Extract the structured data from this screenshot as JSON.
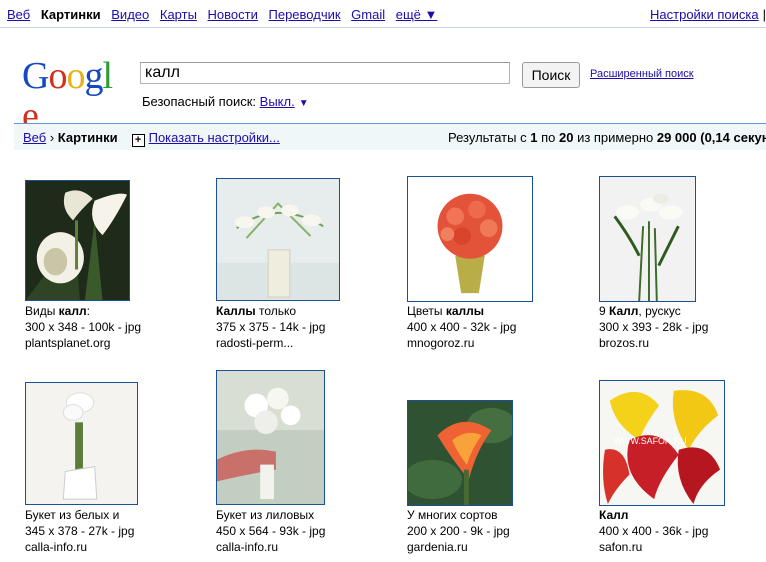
{
  "topnav": {
    "items": [
      "Веб",
      "Картинки",
      "Видео",
      "Карты",
      "Новости",
      "Переводчик",
      "Gmail"
    ],
    "more_label": "ещё ▼",
    "settings_label": "Настройки поиска",
    "separator": "|"
  },
  "logo_letters": [
    "G",
    "o",
    "o",
    "g",
    "l",
    "e"
  ],
  "search": {
    "query": "калл",
    "button_label": "Поиск",
    "advanced_label": "Расширенный поиск"
  },
  "safe_search": {
    "label": "Безопасный поиск:",
    "value": "Выкл.",
    "arrow": "▼"
  },
  "results_bar": {
    "crumb_web": "Веб",
    "crumb_sep": "›",
    "crumb_current": "Картинки",
    "plus": "+",
    "show_settings": "Показать настройки...",
    "stats_prefix": "Результаты с",
    "from": "1",
    "to_word": "по",
    "to": "20",
    "of_word": "из примерно",
    "total": "29 000",
    "time": "(0,14 секун"
  },
  "colors": {
    "link": "#1a0dab",
    "domain": "#228822",
    "meta": "#666666",
    "bar_bg": "#f0f7f9"
  },
  "results": [
    {
      "t1": "Виды ",
      "tb": "калл",
      "t2": ":",
      "meta": "300 x 348 - 100k - jpg",
      "domain": "plantsplanet.org",
      "icon": "white-calla-photo"
    },
    {
      "t1": "",
      "tb": "Каллы",
      "t2": " только",
      "meta": "375 x 375 - 14k - jpg",
      "domain": "radosti-perm...",
      "icon": "calla-vase-photo"
    },
    {
      "t1": "Цветы ",
      "tb": "каллы",
      "t2": "",
      "meta": "400 x 400 - 32k - jpg",
      "domain": "mnogoroz.ru",
      "icon": "orange-bouquet-photo"
    },
    {
      "t1": "9 ",
      "tb": "Калл",
      "t2": ", рускус",
      "meta": "300 x 393 - 28k - jpg",
      "domain": "brozos.ru",
      "icon": "calla-glass-photo"
    },
    {
      "t1": "Букет из белых и",
      "tb": "",
      "t2": "",
      "meta": "345 x 378 - 27k - jpg",
      "domain": "calla-info.ru",
      "icon": "bridal-bouquet-photo"
    },
    {
      "t1": "Букет из лиловых",
      "tb": "",
      "t2": "",
      "meta": "450 x 564 - 93k - jpg",
      "domain": "calla-info.ru",
      "icon": "hand-bouquet-photo"
    },
    {
      "t1": "У многих сортов",
      "tb": "",
      "t2": "",
      "meta": "200 x 200 - 9k - jpg",
      "domain": "gardenia.ru",
      "icon": "orange-calla-photo"
    },
    {
      "t1": "",
      "tb": "Калл",
      "t2": "",
      "meta": "400 x 400 - 36k - jpg",
      "domain": "safon.ru",
      "icon": "yellow-red-calla-photo",
      "watermark": "WWW.SAFON.RU"
    }
  ]
}
